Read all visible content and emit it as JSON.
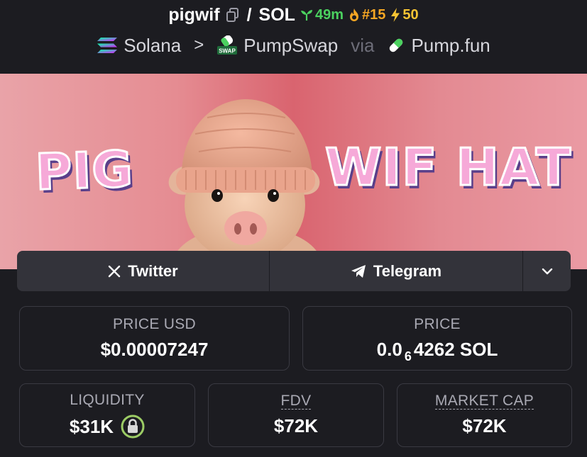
{
  "header": {
    "token_name": "pigwif",
    "separator": "/",
    "quote_symbol": "SOL",
    "age": "49m",
    "rank": "#15",
    "boosts": "50",
    "chain": "Solana",
    "crumb_separator": ">",
    "dex": "PumpSwap",
    "dex_badge": "SWAP",
    "via": "via",
    "launchpad": "Pump.fun"
  },
  "banner": {
    "left_text": "PIG",
    "right_text": "WIF HAT"
  },
  "socials": {
    "twitter": "Twitter",
    "telegram": "Telegram"
  },
  "stats": {
    "price_usd_label": "PRICE USD",
    "price_usd_value": "$0.00007247",
    "price_label": "PRICE",
    "price_prefix": "0.0",
    "price_zeros": "6",
    "price_rest": "4262 SOL",
    "liquidity_label": "LIQUIDITY",
    "liquidity_value": "$31K",
    "fdv_label": "FDV",
    "fdv_value": "$72K",
    "mcap_label": "MARKET CAP",
    "mcap_value": "$72K"
  },
  "colors": {
    "background": "#1c1c21",
    "age_green": "#4bd15f",
    "rank_orange": "#f5a623",
    "boost_yellow": "#f6c433",
    "lock_green": "#9ccc65"
  },
  "icons": [
    "copy-icon",
    "seedling-icon",
    "fire-icon",
    "lightning-icon",
    "solana-icon",
    "pumpswap-icon",
    "pill-icon",
    "x-icon",
    "telegram-icon",
    "chevron-down-icon",
    "lock-icon"
  ]
}
